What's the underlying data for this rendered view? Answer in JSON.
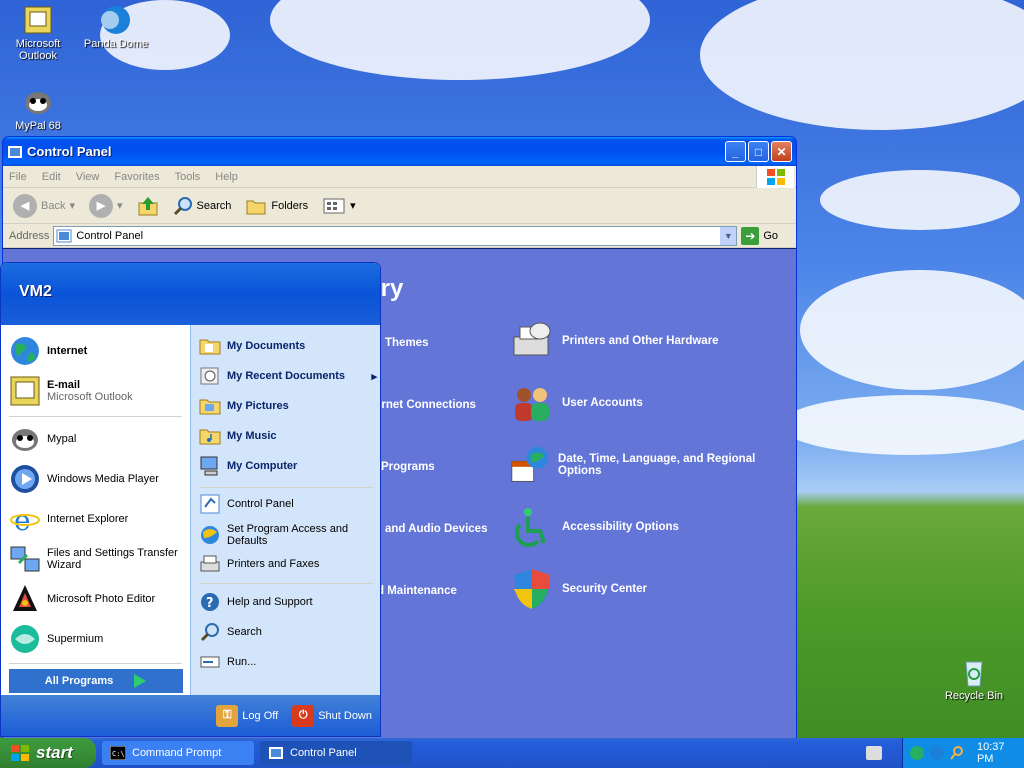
{
  "desktop": {
    "icons": [
      {
        "label": "Microsoft Outlook",
        "icon": "outlook-icon"
      },
      {
        "label": "Panda Dome",
        "icon": "panda-dome-icon"
      },
      {
        "label": "MyPal 68",
        "icon": "mypal-icon"
      },
      {
        "label": "Recycle Bin",
        "icon": "recycle-bin-icon"
      }
    ]
  },
  "window": {
    "title": "Control Panel",
    "menu": [
      "File",
      "Edit",
      "View",
      "Favorites",
      "Tools",
      "Help"
    ],
    "toolbar": {
      "back": "Back",
      "search": "Search",
      "folders": "Folders"
    },
    "address": {
      "label": "Address",
      "value": "Control Panel",
      "go": "Go"
    },
    "heading_partial": "egory",
    "categories_left": [
      "Themes",
      "ernet Connections",
      "Programs",
      "and Audio Devices",
      "d Maintenance"
    ],
    "categories_right": [
      {
        "label": "Printers and Other Hardware",
        "icon": "printer-icon"
      },
      {
        "label": "User Accounts",
        "icon": "users-icon"
      },
      {
        "label": "Date, Time, Language, and Regional Options",
        "icon": "calendar-globe-icon"
      },
      {
        "label": "Accessibility Options",
        "icon": "accessibility-icon"
      },
      {
        "label": "Security Center",
        "icon": "shield-icon"
      }
    ]
  },
  "start_menu": {
    "user": "VM2",
    "pinned": [
      {
        "name": "Internet",
        "icon": "globe-icon"
      },
      {
        "name": "E-mail",
        "sub": "Microsoft Outlook",
        "icon": "outlook-icon"
      }
    ],
    "recent": [
      {
        "name": "Mypal",
        "icon": "mypal-icon"
      },
      {
        "name": "Windows Media Player",
        "icon": "media-player-icon"
      },
      {
        "name": "Internet Explorer",
        "icon": "ie-icon"
      },
      {
        "name": "Files and Settings Transfer Wizard",
        "icon": "transfer-icon"
      },
      {
        "name": "Microsoft Photo Editor",
        "icon": "photo-editor-icon"
      },
      {
        "name": "Supermium",
        "icon": "supermium-icon"
      }
    ],
    "all_programs": "All Programs",
    "places": [
      "My Documents",
      "My Recent Documents",
      "My Pictures",
      "My Music",
      "My Computer"
    ],
    "system": [
      "Control Panel",
      "Set Program Access and Defaults",
      "Printers and Faxes"
    ],
    "help": [
      "Help and Support",
      "Search",
      "Run..."
    ],
    "log_off": "Log Off",
    "shut_down": "Shut Down"
  },
  "taskbar": {
    "start": "start",
    "tasks": [
      {
        "label": "Command Prompt",
        "icon": "cmd-icon"
      },
      {
        "label": "Control Panel",
        "icon": "control-panel-icon"
      }
    ],
    "clock": "10:37 PM"
  }
}
